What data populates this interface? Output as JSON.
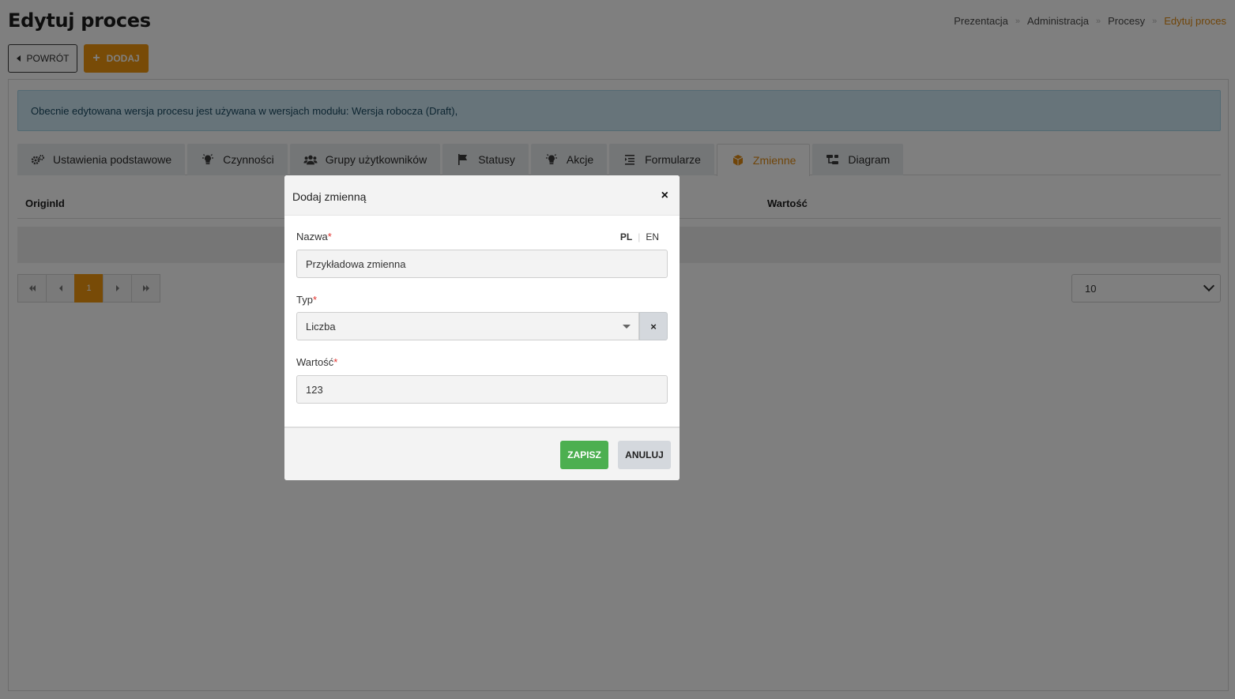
{
  "page": {
    "title": "Edytuj proces"
  },
  "breadcrumb": [
    {
      "label": "Prezentacja"
    },
    {
      "label": "Administracja"
    },
    {
      "label": "Procesy"
    },
    {
      "label": "Edytuj proces",
      "active": true
    }
  ],
  "breadcrumb_separator": "»",
  "toolbar": {
    "back_label": "POWRÓT",
    "add_label": "DODAJ"
  },
  "alert": {
    "text": "Obecnie edytowana wersja procesu jest używana w wersjach modułu: Wersja robocza (Draft),"
  },
  "tabs": [
    {
      "label": "Ustawienia podstawowe",
      "icon": "cogs-icon"
    },
    {
      "label": "Czynności",
      "icon": "lightbulb-icon"
    },
    {
      "label": "Grupy użytkowników",
      "icon": "users-icon"
    },
    {
      "label": "Statusy",
      "icon": "flag-icon"
    },
    {
      "label": "Akcje",
      "icon": "lightbulb-icon"
    },
    {
      "label": "Formularze",
      "icon": "list-icon"
    },
    {
      "label": "Zmienne",
      "icon": "cube-icon",
      "active": true
    },
    {
      "label": "Diagram",
      "icon": "diagram-icon"
    }
  ],
  "table": {
    "columns": [
      "OriginId",
      "Wartość"
    ]
  },
  "pagination": {
    "current_page": "1",
    "page_size": "10"
  },
  "modal": {
    "title": "Dodaj zmienną",
    "close_symbol": "×",
    "fields": {
      "name": {
        "label": "Nazwa",
        "required": "*",
        "value": "Przykładowa zmienna"
      },
      "type": {
        "label": "Typ",
        "required": "*",
        "value": "Liczba",
        "clear_symbol": "×"
      },
      "value": {
        "label": "Wartość",
        "required": "*",
        "value": "123"
      }
    },
    "languages": [
      "PL",
      "EN"
    ],
    "active_language": "PL",
    "buttons": {
      "save": "ZAPISZ",
      "cancel": "ANULUJ"
    }
  },
  "colors": {
    "accent": "#f0960e",
    "success": "#4caf50",
    "required": "#e2322e",
    "alert_bg": "#cfe9f4"
  }
}
